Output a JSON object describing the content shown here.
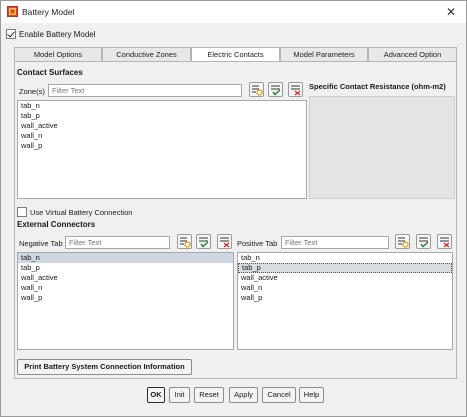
{
  "window": {
    "title": "Battery Model",
    "close_glyph": "✕"
  },
  "enable_battery_model": {
    "label": "Enable Battery Model",
    "checked": true
  },
  "tabs": [
    {
      "label": "Model Options",
      "active": false
    },
    {
      "label": "Conductive Zones",
      "active": false
    },
    {
      "label": "Electric Contacts",
      "active": true
    },
    {
      "label": "Model Parameters",
      "active": false
    },
    {
      "label": "Advanced Option",
      "active": false
    }
  ],
  "contact_surfaces": {
    "title": "Contact Surfaces",
    "zones_label": "Zone(s)",
    "filter_placeholder": "Filter Text",
    "items": [
      "tab_n",
      "tab_p",
      "wall_active",
      "wall_n",
      "wall_p"
    ],
    "resistance_title": "Specific Contact Resistance (ohm-m2)"
  },
  "virtual_connection": {
    "label": "Use Virtual Battery Connection",
    "checked": false
  },
  "external_connectors": {
    "title": "External Connectors",
    "negative": {
      "label": "Negative Tab",
      "filter_placeholder": "Filter Text",
      "items": [
        "tab_n",
        "tab_p",
        "wall_active",
        "wall_n",
        "wall_p"
      ],
      "selected": "tab_n"
    },
    "positive": {
      "label": "Positive Tab",
      "filter_placeholder": "Filter Text",
      "items": [
        "tab_n",
        "tab_p",
        "wall_active",
        "wall_n",
        "wall_p"
      ],
      "selected": "tab_p"
    }
  },
  "print_button": "Print Battery System Connection Information",
  "footer": {
    "ok": "OK",
    "init": "Init",
    "reset": "Reset",
    "apply": "Apply",
    "cancel": "Cancel",
    "help": "Help"
  },
  "icons": {
    "app": "battery-model-icon",
    "select_all": "select-all-icon",
    "select_checked": "check-list-icon",
    "deselect": "deselect-list-icon"
  }
}
